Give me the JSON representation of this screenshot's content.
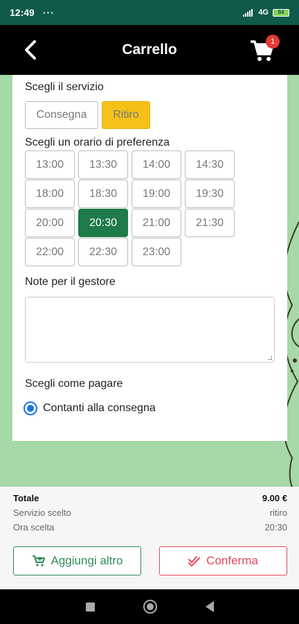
{
  "status": {
    "time": "12:49",
    "dots": "···",
    "network": "4G",
    "battery": "84"
  },
  "header": {
    "title": "Carrello",
    "cart_count": "1"
  },
  "service": {
    "label": "Scegli il servizio",
    "options": [
      {
        "label": "Consegna",
        "selected": false
      },
      {
        "label": "Ritiro",
        "selected": true
      }
    ]
  },
  "time": {
    "label": "Scegli un orario di preferenza",
    "slots": [
      "13:00",
      "13:30",
      "14:00",
      "14:30",
      "18:00",
      "18:30",
      "19:00",
      "19:30",
      "20:00",
      "20:30",
      "21:00",
      "21:30",
      "22:00",
      "22:30",
      "23:00"
    ],
    "selected": "20:30"
  },
  "notes": {
    "label": "Note per il gestore",
    "value": ""
  },
  "payment": {
    "label": "Scegli come pagare",
    "option": "Contanti alla consegna"
  },
  "summary": {
    "total_label": "Totale",
    "total_value": "9.00 €",
    "service_label": "Servizio scelto",
    "service_value": "ritiro",
    "time_label": "Ora scelta",
    "time_value": "20:30"
  },
  "actions": {
    "add_label": "Aggiungi altro",
    "confirm_label": "Conferma"
  },
  "colors": {
    "accent_green": "#1e7a49",
    "accent_yellow": "#f5c118",
    "confirm_red": "#e3485a",
    "header": "#000000"
  }
}
